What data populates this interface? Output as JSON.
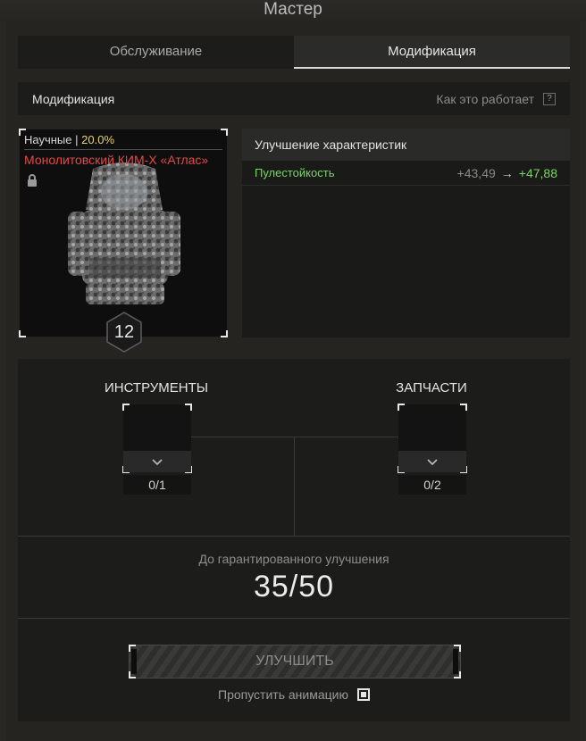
{
  "window": {
    "title": "Мастер"
  },
  "tabs": [
    {
      "label": "Обслуживание",
      "active": false
    },
    {
      "label": "Модификация",
      "active": true
    }
  ],
  "section": {
    "title": "Модификация",
    "how_it_works": "Как это работает",
    "help_glyph": "?"
  },
  "item": {
    "category": "Научные",
    "separator": "|",
    "percent": "20.0%",
    "name": "Монолитовский КИМ-Х «Атлас»",
    "level": "12",
    "locked": true,
    "name_color": "#e24a4a"
  },
  "stats": {
    "header": "Улучшение характеристик",
    "rows": [
      {
        "name": "Пулестойкость",
        "old": "+43,49",
        "arrow": "→",
        "new": "+47,88"
      }
    ]
  },
  "upgrade": {
    "tools": {
      "title": "ИНСТРУМЕНТЫ",
      "count": "0/1"
    },
    "parts": {
      "title": "ЗАПЧАСТИ",
      "count": "0/2"
    },
    "guarantee_label": "До гарантированного улучшения",
    "guarantee_value": "35/50",
    "button": "УЛУЧШИТЬ",
    "skip_label": "Пропустить анимацию",
    "skip_checked": true
  },
  "colors": {
    "accent_green": "#7bd46a",
    "accent_yellow": "#e8d46b"
  }
}
